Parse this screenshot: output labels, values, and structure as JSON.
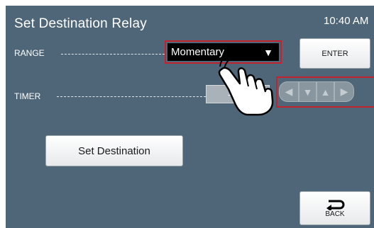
{
  "header": {
    "title": "Set Destination Relay",
    "clock": "10:40 AM"
  },
  "range": {
    "label": "RANGE",
    "selected": "Momentary"
  },
  "timer": {
    "label": "TIMER",
    "value": "- -"
  },
  "buttons": {
    "enter": "ENTER",
    "back": "BACK",
    "set_destination": "Set Destination"
  },
  "colors": {
    "screen_bg": "#4e6678",
    "highlight": "#c2232c"
  },
  "icons": {
    "dropdown_arrow": "caret-down-icon",
    "back": "return-arrow-icon",
    "pointer": "pointing-hand-icon",
    "arrows": [
      "left-arrow-icon",
      "down-arrow-icon",
      "up-arrow-icon",
      "right-arrow-icon"
    ]
  }
}
